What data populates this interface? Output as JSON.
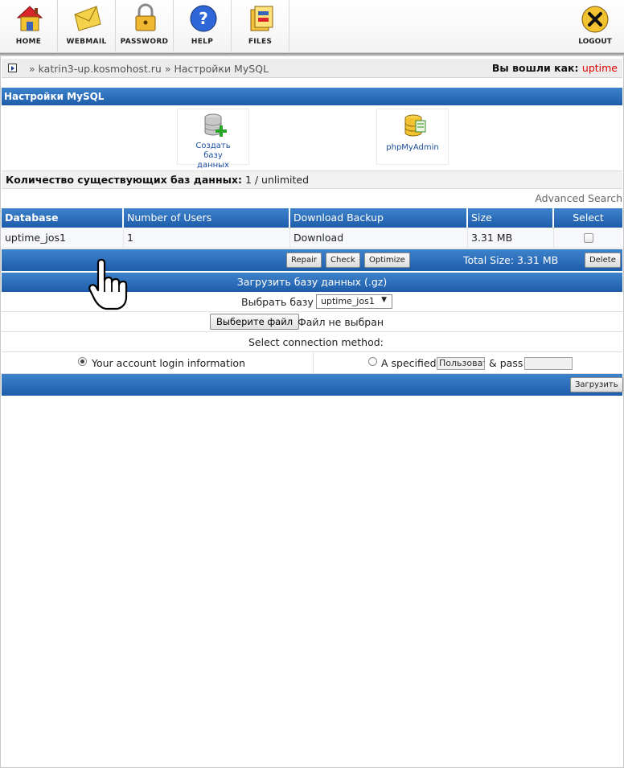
{
  "toolbar": {
    "home": "HOME",
    "webmail": "WEBMAIL",
    "password": "PASSWORD",
    "help": "HELP",
    "files": "FILES",
    "logout": "LOGOUT"
  },
  "breadcrumb": {
    "sep": "»",
    "domain": "katrin3-up.kosmohost.ru",
    "page": "Настройки MySQL"
  },
  "session": {
    "label": "Вы вошли как:",
    "user": "uptime"
  },
  "section_title": "Настройки MySQL",
  "actions": {
    "create_db": "Создать базу данных",
    "phpmyadmin": "phpMyAdmin"
  },
  "count": {
    "label": "Количество существующих баз данных:",
    "value": "1 / unlimited"
  },
  "advanced_search": "Advanced Search",
  "table": {
    "headers": [
      "Database",
      "Number of Users",
      "Download Backup",
      "Size",
      "Select"
    ],
    "rows": [
      {
        "database": "uptime_jos1",
        "users": "1",
        "download": "Download",
        "size": "3.31 MB",
        "selected": false
      }
    ]
  },
  "table_actions": {
    "repair": "Repair",
    "check": "Check",
    "optimize": "Optimize",
    "total_size": "Total Size: 3.31 MB",
    "delete": "Delete"
  },
  "upload": {
    "title": "Загрузить базу данных (.gz)",
    "choose_db_label": "Выбрать базу",
    "choose_db_value": "uptime_jos1",
    "file_button": "Выберите файл",
    "file_status": "Файл не выбран",
    "connection_label": "Select connection method:",
    "option_account": "Your account login information",
    "option_specified": "A specified",
    "user_placeholder": "Пользоват",
    "pass_label": "& pass",
    "submit": "Загрузить"
  },
  "colors": {
    "header_blue": "#2a6cb8",
    "username_red": "#e00000"
  }
}
